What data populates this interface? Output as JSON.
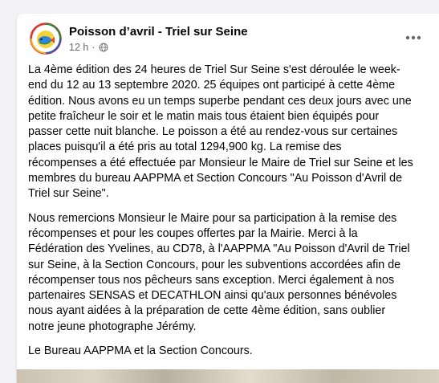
{
  "post": {
    "page_name": "Poisson d’avril - Triel sur Seine",
    "time": "12 h",
    "visibility_icon": "globe-icon",
    "more_icon": "more-options-icon",
    "paragraphs": [
      "La 4ème édition des 24 heures de Triel Sur Seine s'est déroulée le week-end du 12 au 13 septembre 2020. 25 équipes ont participé à cette 4ème édition. Nous avons eu un temps superbe pendant ces deux jours avec une petite fraîcheur le soir et le matin mais tous étaient bien équipés pour passer cette nuit blanche. Le poisson a été au rendez-vous sur certaines places puisqu'il a été pris au total 1294,900 kg. La remise des récompenses a été effectuée par Monsieur le Maire de Triel sur Seine et les membres du bureau AAPPMA et Section Concours \"Au Poisson d'Avril de Triel sur Seine\".",
      "Nous remercions Monsieur le Maire pour sa participation à la remise des récompenses et pour les coupes offertes par la Mairie. Merci à la Fédération des Yvelines, au CD78, à l'AAPPMA \"Au Poisson d'Avril de Triel sur Seine, à la Section Concours, pour les subventions accordées afin de récompenser tous nos pêcheurs sans exception. Merci également à nos partenaires SENSAS et DECATHLON ainsi qu'aux personnes bénévoles nous ayant aidées à la préparation de cette 4ème édition, sans oublier notre jeune photographe Jérémy.",
      "Le Bureau AAPPMA et la Section Concours."
    ]
  },
  "colors": {
    "page_background": "#f0f2f5",
    "card_background": "#ffffff",
    "text_primary": "#050505",
    "text_secondary": "#65676b"
  }
}
